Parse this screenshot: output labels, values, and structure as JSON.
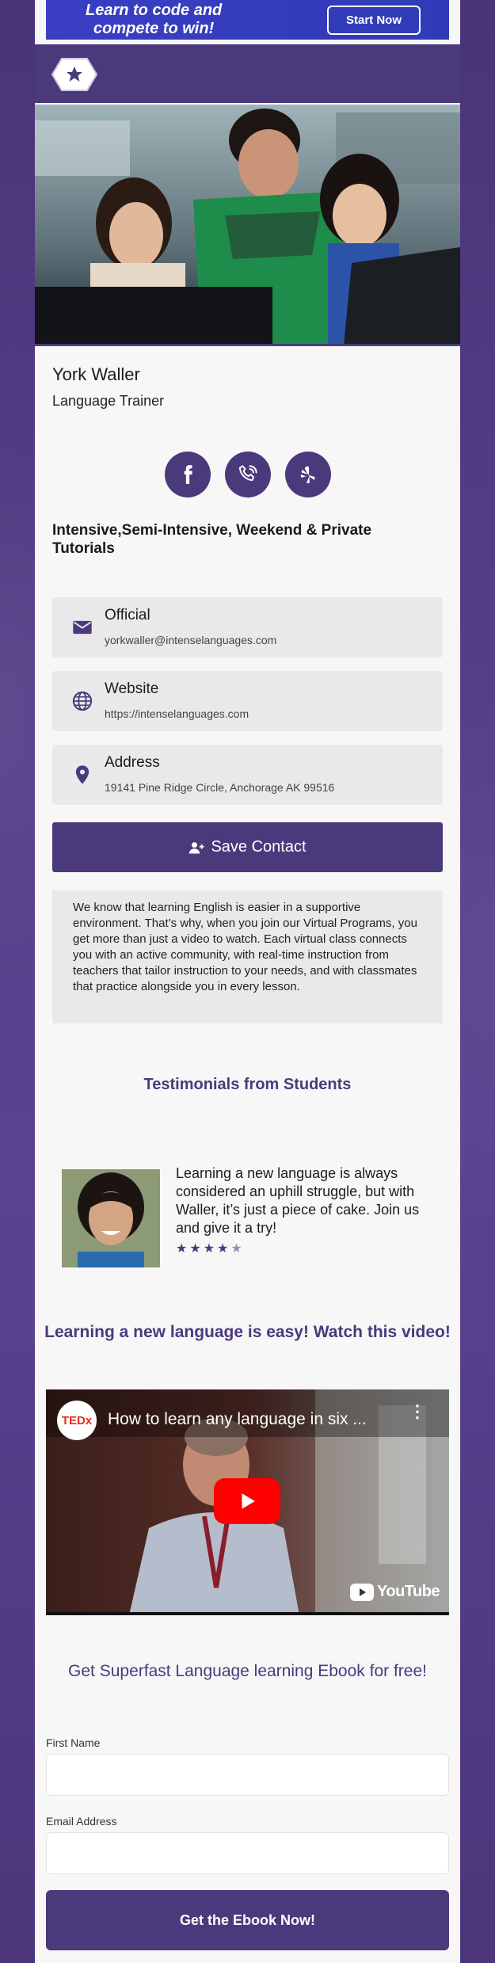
{
  "banner": {
    "line1": "Learn to code and",
    "line2": "compete to win!",
    "button": "Start Now"
  },
  "profile": {
    "name": "York Waller",
    "role": "Language Trainer",
    "tagline": "Intensive,Semi-Intensive, Weekend & Private Tutorials"
  },
  "socials": [
    {
      "icon": "facebook-icon"
    },
    {
      "icon": "phone-icon"
    },
    {
      "icon": "yelp-icon"
    }
  ],
  "contacts": {
    "official": {
      "title": "Official",
      "value": "yorkwaller@intenselanguages.com",
      "icon": "email-icon"
    },
    "website": {
      "title": "Website",
      "value": "https://intenselanguages.com",
      "icon": "globe-icon"
    },
    "address": {
      "title": "Address",
      "value": "19141 Pine Ridge Circle, Anchorage AK 99516",
      "icon": "location-pin-icon"
    }
  },
  "save_contact": "Save Contact",
  "about": "We know that learning English is easier in a supportive environment. That’s why, when you join our Virtual Programs, you get more than just a video to watch. Each virtual class connects you with an active community, with real-time instruction from teachers that tailor instruction to your needs, and with classmates that practice alongside you in every lesson.",
  "testimonials": {
    "title": "Testimonials from Students",
    "quote": "Learning a new language is always considered an uphill struggle, but with Waller, it’s just a piece of cake. Join us and give it a try!",
    "rating": 4.5
  },
  "video": {
    "section_title": "Learning a new language is easy! Watch this video!",
    "title": "How to learn any language in six ...",
    "channel_badge": "TEDx",
    "platform": "YouTube"
  },
  "ebook": {
    "title": "Get Superfast Language learning Ebook for free!",
    "first_name_label": "First Name",
    "email_label": "Email Address",
    "button": "Get the Ebook Now!"
  },
  "colors": {
    "brand": "#4a3a7c",
    "banner": "#3a3fc4",
    "youtube_red": "#ff0000"
  }
}
